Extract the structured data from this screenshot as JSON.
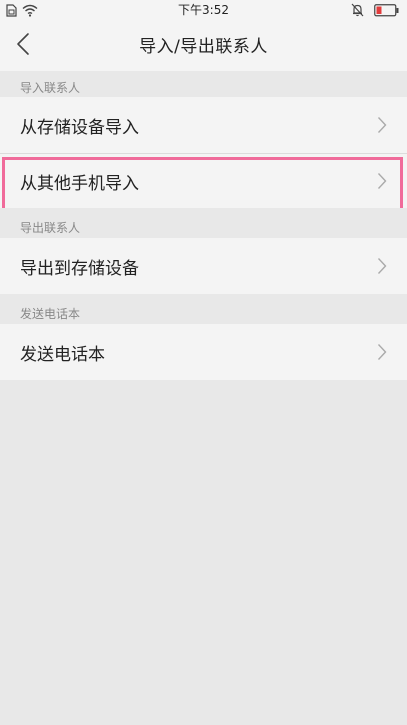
{
  "status_bar": {
    "time": "下午3:52",
    "left_icons": [
      "sim-icon",
      "wifi-icon"
    ],
    "right_icons": [
      "mute-bell-icon",
      "battery-low-icon"
    ]
  },
  "header": {
    "title": "导入/导出联系人",
    "back_icon": "chevron-left-icon"
  },
  "sections": [
    {
      "header": "导入联系人",
      "items": [
        {
          "label": "从存储设备导入"
        },
        {
          "label": "从其他手机导入",
          "highlighted": true
        }
      ]
    },
    {
      "header": "导出联系人",
      "items": [
        {
          "label": "导出到存储设备"
        }
      ]
    },
    {
      "header": "发送电话本",
      "items": [
        {
          "label": "发送电话本"
        }
      ]
    }
  ],
  "colors": {
    "highlight": "#f06b9a",
    "battery_low": "#e23c3c",
    "background": "#e8e8e8",
    "row_background": "#f4f4f4"
  }
}
